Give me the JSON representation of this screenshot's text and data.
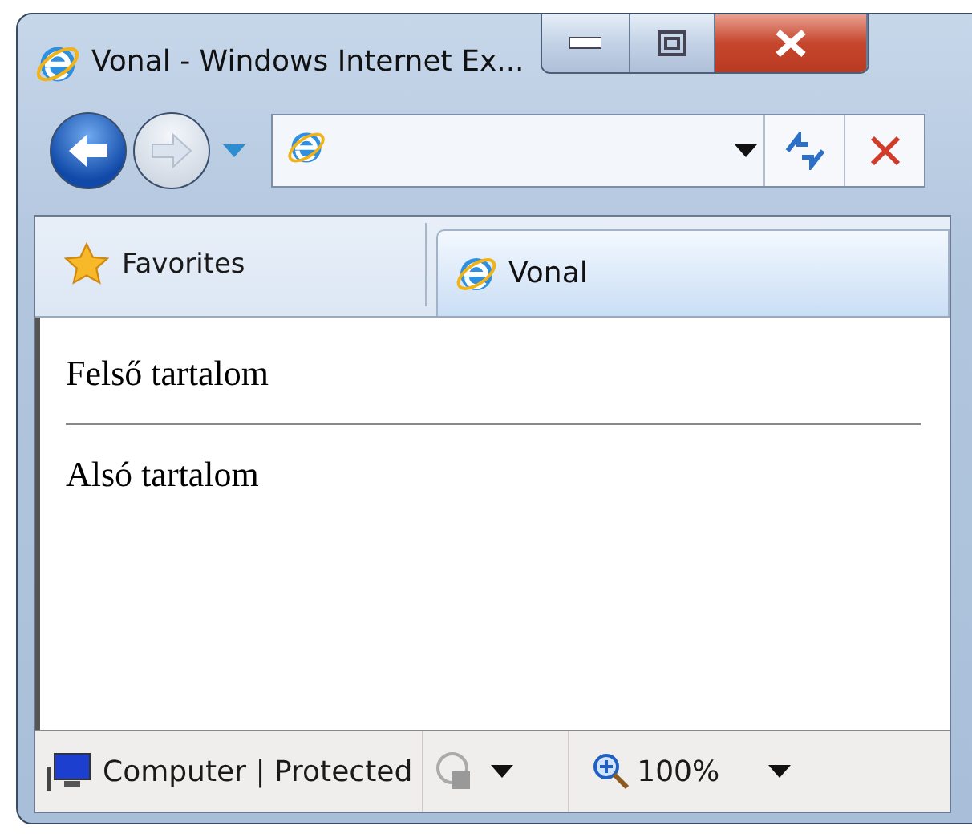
{
  "window": {
    "title": "Vonal - Windows Internet Ex..."
  },
  "favorites": {
    "label": "Favorites"
  },
  "tabs": [
    {
      "label": "Vonal",
      "selected": true
    }
  ],
  "content": {
    "top_text": "Felső tartalom",
    "bottom_text": "Alsó tartalom"
  },
  "status_bar": {
    "zone": "Computer | Protected",
    "zoom": "100%"
  }
}
